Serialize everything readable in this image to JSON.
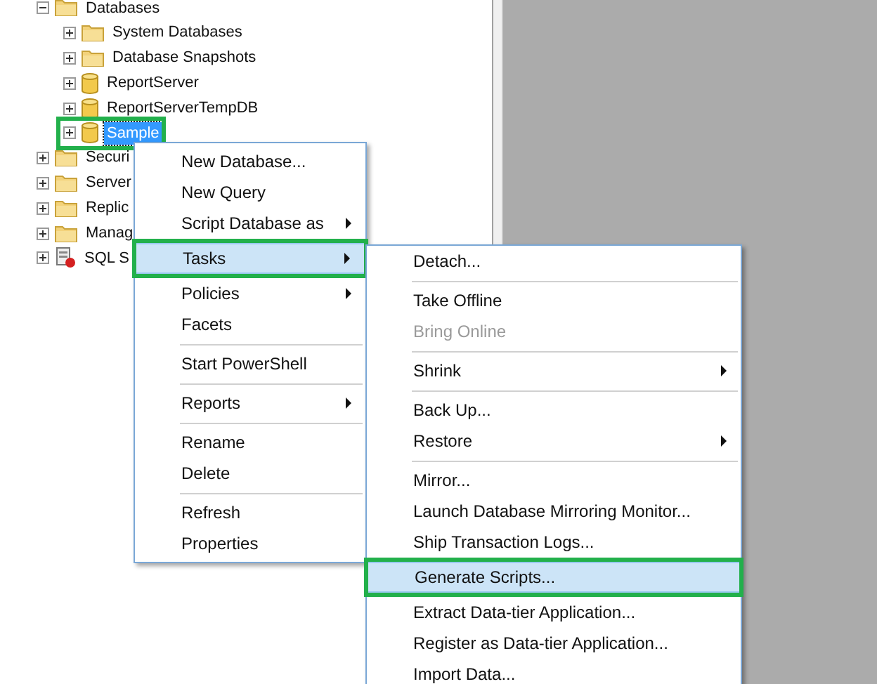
{
  "tree": [
    {
      "label": "Databases",
      "kind": "folder",
      "expanded": true,
      "selected": false,
      "annotated": false,
      "children": [
        {
          "label": "System Databases",
          "kind": "folder",
          "expanded": false,
          "selected": false,
          "annotated": false
        },
        {
          "label": "Database Snapshots",
          "kind": "folder",
          "expanded": false,
          "selected": false,
          "annotated": false
        },
        {
          "label": "ReportServer",
          "kind": "database",
          "expanded": false,
          "selected": false,
          "annotated": false
        },
        {
          "label": "ReportServerTempDB",
          "kind": "database",
          "expanded": false,
          "selected": false,
          "annotated": false
        },
        {
          "label": "Sample",
          "kind": "database",
          "expanded": false,
          "selected": true,
          "annotated": true
        }
      ]
    },
    {
      "label": "Securi",
      "kind": "folder",
      "expanded": false,
      "selected": false,
      "annotated": false
    },
    {
      "label": "Server",
      "kind": "folder",
      "expanded": false,
      "selected": false,
      "annotated": false
    },
    {
      "label": "Replic",
      "kind": "folder",
      "expanded": false,
      "selected": false,
      "annotated": false
    },
    {
      "label": "Manag",
      "kind": "folder",
      "expanded": false,
      "selected": false,
      "annotated": false
    },
    {
      "label": "SQL S",
      "kind": "agent",
      "expanded": false,
      "selected": false,
      "annotated": false
    }
  ],
  "context_menu": [
    {
      "kind": "item",
      "label": "New Database...",
      "submenu": false,
      "disabled": false,
      "selected": false,
      "annotated": false
    },
    {
      "kind": "item",
      "label": "New Query",
      "submenu": false,
      "disabled": false,
      "selected": false,
      "annotated": false
    },
    {
      "kind": "item",
      "label": "Script Database as",
      "submenu": true,
      "disabled": false,
      "selected": false,
      "annotated": false
    },
    {
      "kind": "item",
      "label": "Tasks",
      "submenu": true,
      "disabled": false,
      "selected": true,
      "annotated": true
    },
    {
      "kind": "item",
      "label": "Policies",
      "submenu": true,
      "disabled": false,
      "selected": false,
      "annotated": false
    },
    {
      "kind": "item",
      "label": "Facets",
      "submenu": false,
      "disabled": false,
      "selected": false,
      "annotated": false
    },
    {
      "kind": "separator"
    },
    {
      "kind": "item",
      "label": "Start PowerShell",
      "submenu": false,
      "disabled": false,
      "selected": false,
      "annotated": false
    },
    {
      "kind": "separator"
    },
    {
      "kind": "item",
      "label": "Reports",
      "submenu": true,
      "disabled": false,
      "selected": false,
      "annotated": false
    },
    {
      "kind": "separator"
    },
    {
      "kind": "item",
      "label": "Rename",
      "submenu": false,
      "disabled": false,
      "selected": false,
      "annotated": false
    },
    {
      "kind": "item",
      "label": "Delete",
      "submenu": false,
      "disabled": false,
      "selected": false,
      "annotated": false
    },
    {
      "kind": "separator"
    },
    {
      "kind": "item",
      "label": "Refresh",
      "submenu": false,
      "disabled": false,
      "selected": false,
      "annotated": false
    },
    {
      "kind": "item",
      "label": "Properties",
      "submenu": false,
      "disabled": false,
      "selected": false,
      "annotated": false
    }
  ],
  "tasks_submenu": [
    {
      "kind": "item",
      "label": "Detach...",
      "submenu": false,
      "disabled": false,
      "selected": false,
      "annotated": false
    },
    {
      "kind": "separator"
    },
    {
      "kind": "item",
      "label": "Take Offline",
      "submenu": false,
      "disabled": false,
      "selected": false,
      "annotated": false
    },
    {
      "kind": "item",
      "label": "Bring Online",
      "submenu": false,
      "disabled": true,
      "selected": false,
      "annotated": false
    },
    {
      "kind": "separator"
    },
    {
      "kind": "item",
      "label": "Shrink",
      "submenu": true,
      "disabled": false,
      "selected": false,
      "annotated": false
    },
    {
      "kind": "separator"
    },
    {
      "kind": "item",
      "label": "Back Up...",
      "submenu": false,
      "disabled": false,
      "selected": false,
      "annotated": false
    },
    {
      "kind": "item",
      "label": "Restore",
      "submenu": true,
      "disabled": false,
      "selected": false,
      "annotated": false
    },
    {
      "kind": "separator"
    },
    {
      "kind": "item",
      "label": "Mirror...",
      "submenu": false,
      "disabled": false,
      "selected": false,
      "annotated": false
    },
    {
      "kind": "item",
      "label": "Launch Database Mirroring Monitor...",
      "submenu": false,
      "disabled": false,
      "selected": false,
      "annotated": false
    },
    {
      "kind": "item",
      "label": "Ship Transaction Logs...",
      "submenu": false,
      "disabled": false,
      "selected": false,
      "annotated": false
    },
    {
      "kind": "item",
      "label": "Generate Scripts...",
      "submenu": false,
      "disabled": false,
      "selected": true,
      "annotated": true
    },
    {
      "kind": "item",
      "label": "Extract Data-tier Application...",
      "submenu": false,
      "disabled": false,
      "selected": false,
      "annotated": false
    },
    {
      "kind": "item",
      "label": "Register as Data-tier Application...",
      "submenu": false,
      "disabled": false,
      "selected": false,
      "annotated": false
    },
    {
      "kind": "item",
      "label": "Import Data...",
      "submenu": false,
      "disabled": false,
      "selected": false,
      "annotated": false
    }
  ]
}
